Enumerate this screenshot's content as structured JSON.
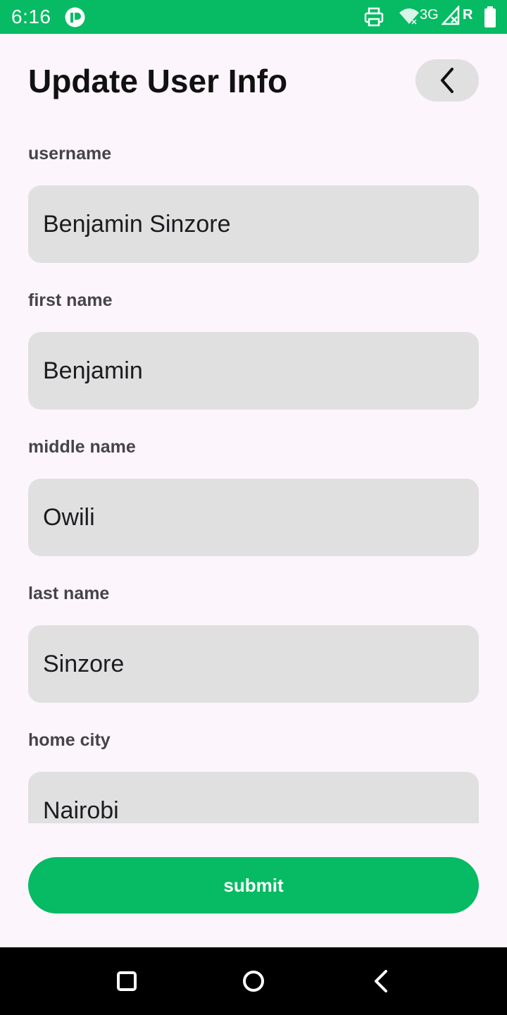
{
  "status_bar": {
    "time": "6:16",
    "network": "3G",
    "roaming": "R",
    "icons": [
      "app-icon",
      "printer-icon",
      "wifi-icon",
      "signal-icon",
      "battery-icon"
    ]
  },
  "header": {
    "title": "Update User Info",
    "back_icon": "chevron-left-icon"
  },
  "form": {
    "fields": [
      {
        "label": "username",
        "value": "Benjamin Sinzore"
      },
      {
        "label": "first name",
        "value": "Benjamin"
      },
      {
        "label": "middle name",
        "value": "Owili"
      },
      {
        "label": "last name",
        "value": "Sinzore"
      },
      {
        "label": "home city",
        "value": "Nairobi"
      }
    ],
    "submit_label": "submit"
  },
  "nav_bar": {
    "icons": [
      "recents-square-icon",
      "home-circle-icon",
      "back-triangle-icon"
    ]
  },
  "colors": {
    "accent": "#06bb63",
    "background": "#fcf5fc",
    "field_bg": "#e0e0e0"
  }
}
